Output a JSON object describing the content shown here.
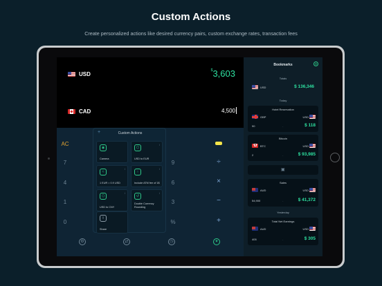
{
  "headline": "Custom Actions",
  "subline": "Create personalized actions like desired currency pairs, custom exchange rates, transaction fees",
  "rows": [
    {
      "code": "USD",
      "amount": "3,603",
      "prefix": "$"
    },
    {
      "code": "CAD",
      "amount": "4,500"
    }
  ],
  "keypad": {
    "ac": "AC",
    "keys": [
      "7",
      "4",
      "1",
      "0",
      "9",
      "6",
      "3",
      "%"
    ],
    "ops": [
      "÷",
      "×",
      "−",
      "+"
    ]
  },
  "popover": {
    "title": "Custom Actions",
    "plus": "+",
    "tiles": [
      {
        "label": "Camera",
        "icon": "camera-icon"
      },
      {
        "label": "USD to EUR",
        "icon": "exchange-icon"
      },
      {
        "label": "1 EUR = 0.9 USD",
        "icon": "rate-icon"
      },
      {
        "label": "Include ATM fee of 1$",
        "icon": "fee-icon"
      },
      {
        "label": "USD to CNY",
        "icon": "exchange-icon"
      },
      {
        "label": "Double Currency Rounding",
        "icon": "rounding-icon"
      },
      {
        "label": "Share",
        "icon": "share-icon"
      }
    ]
  },
  "bookmarks": {
    "title": "Bookmarks",
    "totals_label": "Totals",
    "totals_code": "USD",
    "totals_value": "$ 136,346",
    "today_label": "Today",
    "yesterday_label": "Yesterday",
    "cards": [
      {
        "title": "Hotel Reservation",
        "from": "GBP",
        "to": "USD",
        "qty": "90",
        "value": "$ 118"
      },
      {
        "title": "Bitcoin",
        "from": "BTC",
        "to": "USD",
        "qty": "2",
        "value": "$ 93,985"
      },
      {
        "title": "Sales",
        "from": "AUD",
        "to": "USD",
        "qty": "54,900",
        "value": "$ 41,372"
      },
      {
        "title": "Total Net Earnings",
        "from": "AUD",
        "to": "USD",
        "qty": "405",
        "value": "$ 305"
      }
    ]
  },
  "colors": {
    "accent": "#2ee0a0",
    "background": "#0b1f2a",
    "ac": "#e0a230"
  }
}
